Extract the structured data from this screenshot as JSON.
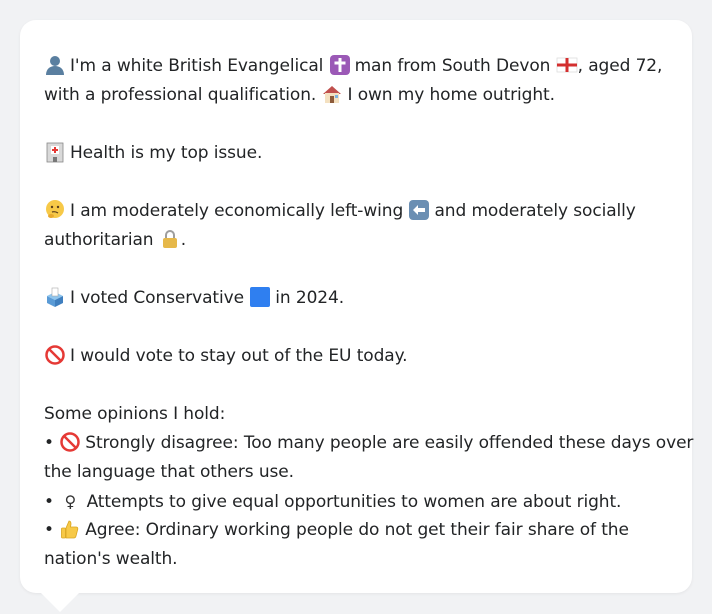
{
  "profile": {
    "identity": {
      "text_1": "I'm a white British Evangelical",
      "text_2": "man from South Devon",
      "text_3": ", aged 72,",
      "text_4": "with a professional qualification.",
      "text_5": "I own my home outright."
    },
    "top_issue": "Health is my top issue.",
    "ideology": {
      "text_1": "I am moderately economically left-wing",
      "text_2": "and moderately socially",
      "text_3": "authoritarian"
    },
    "vote_2024": {
      "text_1": "I voted Conservative",
      "text_2": "in 2024."
    },
    "eu": "I would vote to stay out of the EU today."
  },
  "opinions": {
    "heading": "Some opinions I hold:",
    "bullet": "•",
    "items": [
      {
        "icon": "no-entry-icon",
        "line_1": "Strongly disagree: Too many people are easily offended these days over",
        "line_2": "the language that others use."
      },
      {
        "icon": "female-sign-icon",
        "glyph": "♀",
        "line_1": "Attempts to give equal opportunities to women are about right."
      },
      {
        "icon": "thumbs-up-icon",
        "line_1": "Agree: Ordinary working people do not get their fair share of the",
        "line_2": "nation's wealth."
      }
    ]
  },
  "icons": {
    "person": "bust-silhouette-icon",
    "cross": "latin-cross-icon",
    "flag": "england-flag-icon",
    "house": "house-icon",
    "health": "hospital-icon",
    "thinking": "thinking-face-icon",
    "left": "left-arrow-icon",
    "lock": "locked-icon",
    "ballot": "ballot-box-icon",
    "conservative": "blue-square-icon",
    "eu": "no-entry-icon"
  },
  "colors": {
    "background": "#f1f2f4",
    "card": "#ffffff",
    "text": "#222426",
    "conservative_blue": "#2f7ff0",
    "cross_purple": "#9b59b6",
    "no_entry_red": "#e53935"
  }
}
